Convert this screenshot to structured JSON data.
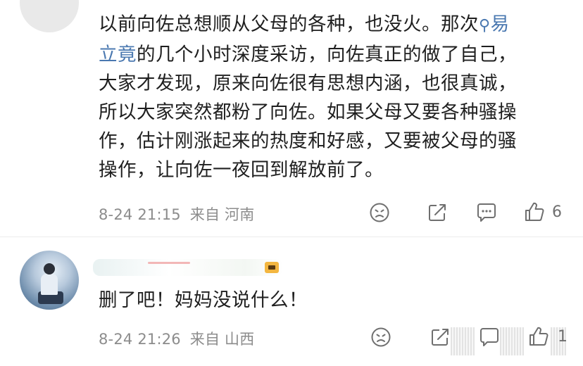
{
  "comment_top": {
    "text_lines": [
      "以前向佐总想顺从父母的各种，也没火。那次",
      "的几个小时深度采访，向佐真正的做了自己，",
      "大家才发现，原来向佐很有思想内涵，也很真诚，",
      "所以大家突然都粉了向佐。如果父母又要各种骚操",
      "作，估计刚涨起来的热度和好感，又要被父母的骚",
      "操作，让向佐一夜回到解放前了。"
    ],
    "mention_line1": "易",
    "mention_line2": "立竟",
    "timestamp": "8-24 21:15",
    "location_prefix": "来自",
    "location": "河南",
    "like_count": "6"
  },
  "comment_reply": {
    "text": "删了吧！妈妈没说什么！",
    "timestamp": "8-24 21:26",
    "location_prefix": "来自",
    "location": "山西",
    "like_count": "1"
  },
  "icons": {
    "reaction": "face-emoji-icon",
    "share": "share-arrow-icon",
    "comment": "comment-bubble-icon",
    "like": "thumbs-up-icon",
    "mention": "search-magnifier-icon"
  },
  "colors": {
    "text": "#1f1f1f",
    "meta": "#8c8c8c",
    "mention": "#4a78b0",
    "icon": "#6f6f6f"
  }
}
